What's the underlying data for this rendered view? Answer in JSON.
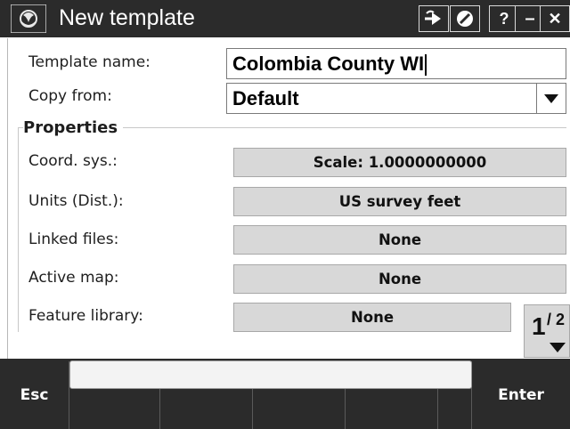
{
  "window": {
    "title": "New template",
    "toolbar": [
      {
        "icon": "forward-arrow-icon"
      },
      {
        "icon": "no-entry-icon"
      }
    ],
    "help_label": "?",
    "minimize_label": "–",
    "close_label": "✕"
  },
  "form": {
    "template_name_label": "Template name:",
    "template_name_value": "Colombia County WI",
    "copy_from_label": "Copy from:",
    "copy_from_value": "Default"
  },
  "properties": {
    "heading": "Properties",
    "rows": [
      {
        "label": "Coord. sys.:",
        "value": "Scale:  1.0000000000"
      },
      {
        "label": "Units (Dist.):",
        "value": "US survey feet"
      },
      {
        "label": "Linked files:",
        "value": "None"
      },
      {
        "label": "Active map:",
        "value": "None"
      },
      {
        "label": "Feature library:",
        "value": "None"
      }
    ]
  },
  "pager": {
    "current": "1",
    "total": "2"
  },
  "softkeys": {
    "esc": "Esc",
    "enter": "Enter"
  }
}
